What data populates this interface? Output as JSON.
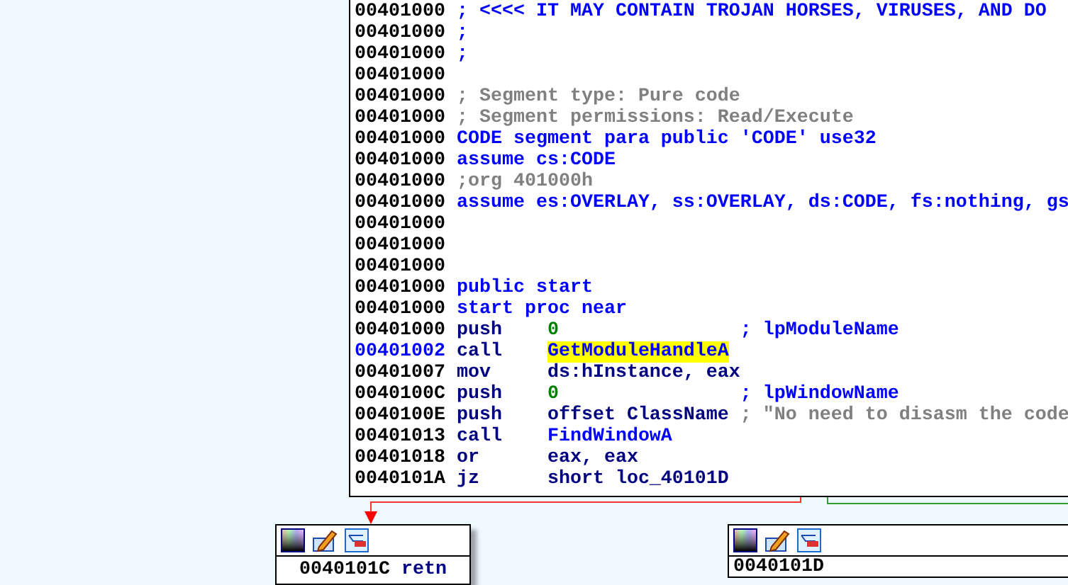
{
  "main_block": {
    "lines": [
      {
        "address": "00401000",
        "kind": "directive",
        "text": "; <<<< IT MAY CONTAIN TROJAN HORSES, VIRUSES, AND DO"
      },
      {
        "address": "00401000",
        "kind": "directive",
        "text": ";"
      },
      {
        "address": "00401000",
        "kind": "directive",
        "text": ";"
      },
      {
        "address": "00401000",
        "kind": "empty"
      },
      {
        "address": "00401000",
        "kind": "comment",
        "text": "; Segment type: Pure code"
      },
      {
        "address": "00401000",
        "kind": "comment",
        "text": "; Segment permissions: Read/Execute"
      },
      {
        "address": "00401000",
        "kind": "directive",
        "text": "CODE segment para public 'CODE' use32"
      },
      {
        "address": "00401000",
        "kind": "directive",
        "text": "assume cs:CODE"
      },
      {
        "address": "00401000",
        "kind": "comment",
        "text": ";org 401000h"
      },
      {
        "address": "00401000",
        "kind": "directive",
        "text": "assume es:OVERLAY, ss:OVERLAY, ds:CODE, fs:nothing, gs"
      },
      {
        "address": "00401000",
        "kind": "empty"
      },
      {
        "address": "00401000",
        "kind": "empty"
      },
      {
        "address": "00401000",
        "kind": "empty"
      },
      {
        "address": "00401000",
        "kind": "directive",
        "text": "public start"
      },
      {
        "address": "00401000",
        "kind": "directive",
        "text": "start proc near"
      },
      {
        "address": "00401000",
        "kind": "instruction",
        "mnemonic": "push",
        "operand": {
          "text": "0",
          "kind": "number"
        },
        "comment": "; lpModuleName"
      },
      {
        "address": "00401002",
        "kind": "instruction",
        "mnemonic": "call",
        "operand": {
          "text": "GetModuleHandleA",
          "kind": "name"
        },
        "highlighted": true
      },
      {
        "address": "00401007",
        "kind": "instruction",
        "mnemonic": "mov",
        "operand": {
          "text": "ds:hInstance, eax",
          "kind": "plain"
        }
      },
      {
        "address": "0040100C",
        "kind": "instruction",
        "mnemonic": "push",
        "operand": {
          "text": "0",
          "kind": "number"
        },
        "comment": "; lpWindowName"
      },
      {
        "address": "0040100E",
        "kind": "instruction",
        "mnemonic": "push",
        "operand": {
          "text": "offset ClassName",
          "kind": "plain"
        },
        "comment": "; \"No need to disasm the code"
      },
      {
        "address": "00401013",
        "kind": "instruction",
        "mnemonic": "call",
        "operand": {
          "text": "FindWindowA",
          "kind": "name"
        }
      },
      {
        "address": "00401018",
        "kind": "instruction",
        "mnemonic": "or",
        "operand": {
          "text": "eax, eax",
          "kind": "plain"
        }
      },
      {
        "address": "0040101A",
        "kind": "instruction",
        "mnemonic": "jz",
        "operand": {
          "text": "short loc_40101D",
          "kind": "plain"
        }
      }
    ]
  },
  "left_block": {
    "lines": [
      {
        "address": "0040101C",
        "mnemonic": "retn"
      }
    ]
  },
  "right_block": {
    "lines": [
      {
        "address": "0040101D"
      }
    ]
  }
}
